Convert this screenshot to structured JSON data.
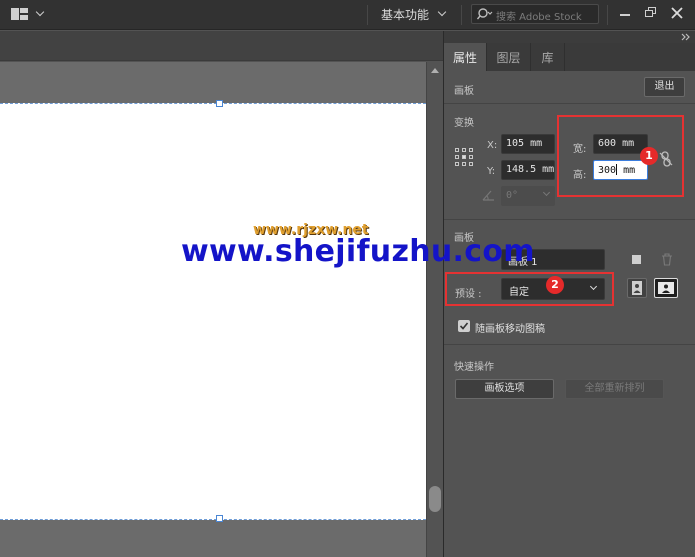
{
  "topbar": {
    "workspace": "基本功能",
    "stock_placeholder": "搜索 Adobe Stock"
  },
  "panel": {
    "tabs": [
      "属性",
      "图层",
      "库"
    ],
    "artboard_header": "画板",
    "exit_button": "退出",
    "transform": {
      "title": "变换",
      "x_label": "X:",
      "x_value": "105 mm",
      "y_label": "Y:",
      "y_value": "148.5 mm",
      "w_label": "宽:",
      "w_value": "600 mm",
      "h_label": "高:",
      "h_value": "300",
      "h_value_unit": " mm",
      "angle_value": "0°"
    },
    "artboard": {
      "title": "画板",
      "name_value": "画板 1",
      "preset_label": "预设 :",
      "preset_value": "自定",
      "move_with_artwork_label": "随画板移动图稿",
      "move_with_artwork_checked": true
    },
    "quick_actions": {
      "title": "快速操作",
      "artboard_options": "画板选项",
      "rearrange_all": "全部重新排列"
    }
  },
  "annotations": {
    "badge1": "1",
    "badge2": "2"
  },
  "watermark": {
    "small": "www.rjzxw.net",
    "big": "www.shejifuzhu.com"
  },
  "colors": {
    "accent_red": "#e53232",
    "focus_blue": "#3b7ddd",
    "watermark_blue": "#1414c8",
    "watermark_orange": "#e0a030"
  }
}
